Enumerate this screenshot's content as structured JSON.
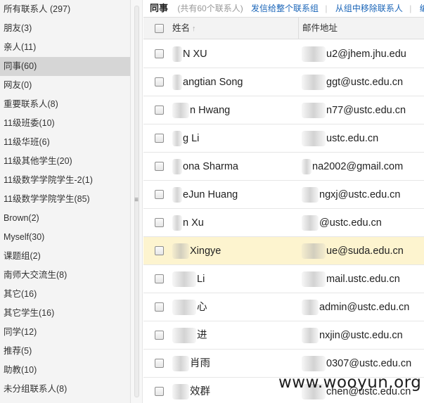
{
  "sidebar": {
    "groups": [
      {
        "label": "所有联系人 (297)"
      },
      {
        "label": "朋友(3)"
      },
      {
        "label": "亲人(11)"
      },
      {
        "label": "同事(60)",
        "selected": true
      },
      {
        "label": "网友(0)"
      },
      {
        "label": "重要联系人(8)"
      },
      {
        "label": "11级班委(10)"
      },
      {
        "label": "11级华班(6)"
      },
      {
        "label": "11级其他学生(20)"
      },
      {
        "label": "11级数学学院学生-2(1)"
      },
      {
        "label": "11级数学学院学生(85)"
      },
      {
        "label": "Brown(2)"
      },
      {
        "label": "Myself(30)"
      },
      {
        "label": "课题组(2)"
      },
      {
        "label": "南师大交流生(8)"
      },
      {
        "label": "其它(16)"
      },
      {
        "label": "其它学生(16)"
      },
      {
        "label": "同学(12)"
      },
      {
        "label": "推荐(5)"
      },
      {
        "label": "助教(10)"
      },
      {
        "label": "未分组联系人(8)"
      }
    ]
  },
  "splitter": {
    "grip_glyph": "≡"
  },
  "header": {
    "group_title": "同事",
    "count_text": "(共有60个联系人)",
    "send_to_group": "发信给整个联系组",
    "separator": "|",
    "remove_from_group": "从组中移除联系人",
    "edit": "编辑"
  },
  "table": {
    "columns": {
      "name": "姓名",
      "email": "邮件地址",
      "sort_arrow": "↑"
    },
    "rows": [
      {
        "name": "N XU",
        "email": "u2@jhem.jhu.edu",
        "name_blur": "w1",
        "email_blur": "w3"
      },
      {
        "name": "angtian Song",
        "email": "ggt@ustc.edu.cn",
        "name_blur": "w1",
        "email_blur": "w3"
      },
      {
        "name": "n Hwang",
        "email": "n77@ustc.edu.cn",
        "name_blur": "w2",
        "email_blur": "w3"
      },
      {
        "name": "g Li",
        "email": "ustc.edu.cn",
        "name_blur": "w1",
        "email_blur": "w3"
      },
      {
        "name": "ona Sharma",
        "email": "na2002@gmail.com",
        "name_blur": "w1",
        "email_blur": "w1"
      },
      {
        "name": "eJun Huang",
        "email": "ngxj@ustc.edu.cn",
        "name_blur": "w1",
        "email_blur": "w2"
      },
      {
        "name": "n Xu",
        "email": "@ustc.edu.cn",
        "name_blur": "w1",
        "email_blur": "w2"
      },
      {
        "name": "Xingye",
        "email": "ue@suda.edu.cn",
        "name_blur": "w2",
        "email_blur": "w3",
        "highlight": true
      },
      {
        "name": "Li",
        "email": "mail.ustc.edu.cn",
        "name_blur": "w3",
        "email_blur": "w3"
      },
      {
        "name": "心",
        "email": "admin@ustc.edu.cn",
        "name_blur": "w3",
        "email_blur": "w2"
      },
      {
        "name": "进",
        "email": "nxjin@ustc.edu.cn",
        "name_blur": "w3",
        "email_blur": "w2"
      },
      {
        "name": "肖雨",
        "email": "0307@ustc.edu.cn",
        "name_blur": "w2",
        "email_blur": "w3"
      },
      {
        "name": "效群",
        "email": "chen@ustc.edu.cn",
        "name_blur": "w2",
        "email_blur": "w3"
      }
    ]
  },
  "watermark": "www.wooyun.org"
}
